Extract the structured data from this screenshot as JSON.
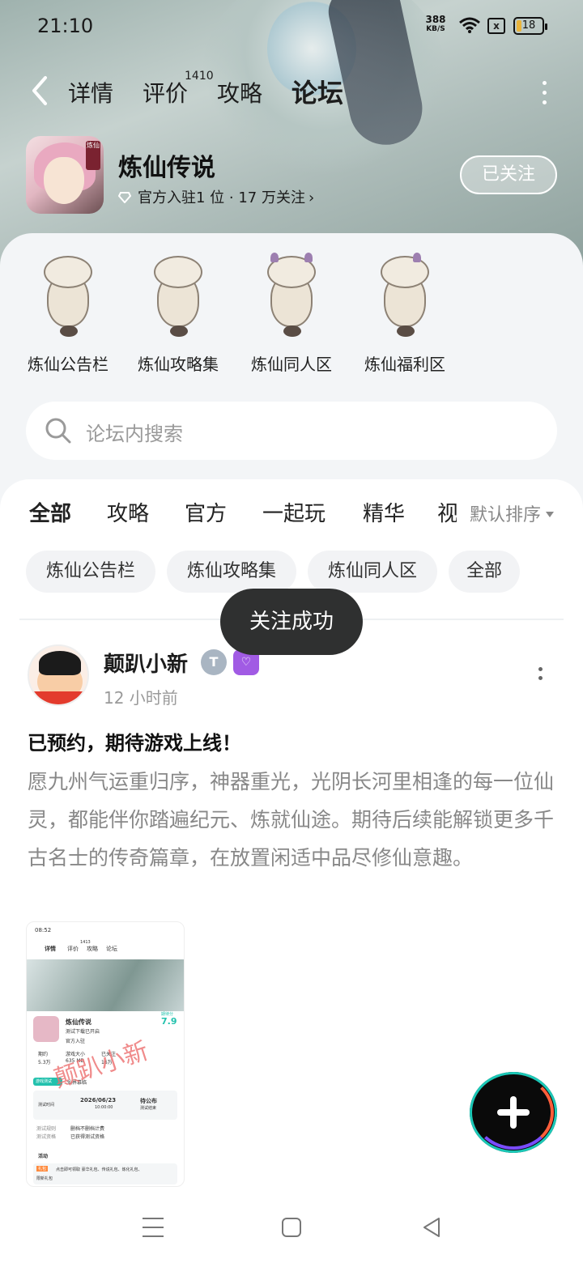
{
  "status_bar": {
    "time": "21:10",
    "net_speed_value": "388",
    "net_speed_unit": "KB/S",
    "sim_icon": "x",
    "battery": "18"
  },
  "nav": {
    "tabs": [
      {
        "label": "详情"
      },
      {
        "label": "评价",
        "count": "1410"
      },
      {
        "label": "攻略"
      },
      {
        "label": "论坛"
      }
    ],
    "active_tab": "论坛"
  },
  "game": {
    "name": "炼仙传说",
    "subtitle": "官方入驻1 位 · 17 万关注",
    "chevron": "›",
    "icon_tag": "炼仙",
    "follow_label": "已关注"
  },
  "sections": [
    {
      "label": "炼仙公告栏"
    },
    {
      "label": "炼仙攻略集"
    },
    {
      "label": "炼仙同人区"
    },
    {
      "label": "炼仙福利区"
    }
  ],
  "search": {
    "placeholder": "论坛内搜索"
  },
  "feed_tabs": [
    {
      "label": "全部"
    },
    {
      "label": "攻略"
    },
    {
      "label": "官方"
    },
    {
      "label": "一起玩"
    },
    {
      "label": "精华"
    },
    {
      "label": "视"
    }
  ],
  "sort": {
    "label": "默认排序"
  },
  "chips": [
    {
      "label": "炼仙公告栏"
    },
    {
      "label": "炼仙攻略集"
    },
    {
      "label": "炼仙同人区"
    },
    {
      "label": "全部"
    }
  ],
  "toast": {
    "text": "关注成功"
  },
  "post": {
    "author": "颠趴小新",
    "badge1": "T",
    "badge2": "♡",
    "time": "12 小时前",
    "title": "已预约，期待游戏上线！",
    "body": "愿九州气运重归序，神器重光，光阴长河里相逢的每一位仙灵，都能伴你踏遍纪元、炼就仙途。期待后续能解锁更多千古名士的传奇篇章，在放置闲适中品尽修仙意趣。",
    "image": {
      "time": "08:52",
      "tabs": [
        "详情",
        "评价",
        "攻略",
        "论坛"
      ],
      "tab_count": "1413",
      "game_name": "炼仙传说",
      "game_sub": "测试下载已开启",
      "game_tag": "官方入驻",
      "score_label": "期待分",
      "score": "7.9",
      "stats": [
        "期约",
        "游戏大小",
        "已关注"
      ],
      "stat_values": [
        "5.3万",
        "635 MB",
        "16万"
      ],
      "test_tag": "游戏测试",
      "test_name": "仙界慕临",
      "test_date": "2026/06/23",
      "test_time": "10:00:00",
      "test_end": "待公布",
      "test_end_sub": "测试结束",
      "test_time_label": "测试时间",
      "rule_label": "测试规则",
      "rule_value": "删档不删档计费",
      "qual_label": "测试资格",
      "qual_value": "已获得测试资格",
      "activity": "活动",
      "gift_tag": "礼包",
      "gift_text": "点击即可领取 豪华礼包、传说礼包、炼化礼包、",
      "gift_text2": "限新礼包",
      "watermark": "颠趴小新"
    }
  },
  "fab": {
    "icon": "plus-icon"
  },
  "colors": {
    "accent": "#20d2bf",
    "toast_bg": "#2f3030",
    "follow_border": "#ffffff",
    "badge_purple": "#a15be4"
  }
}
